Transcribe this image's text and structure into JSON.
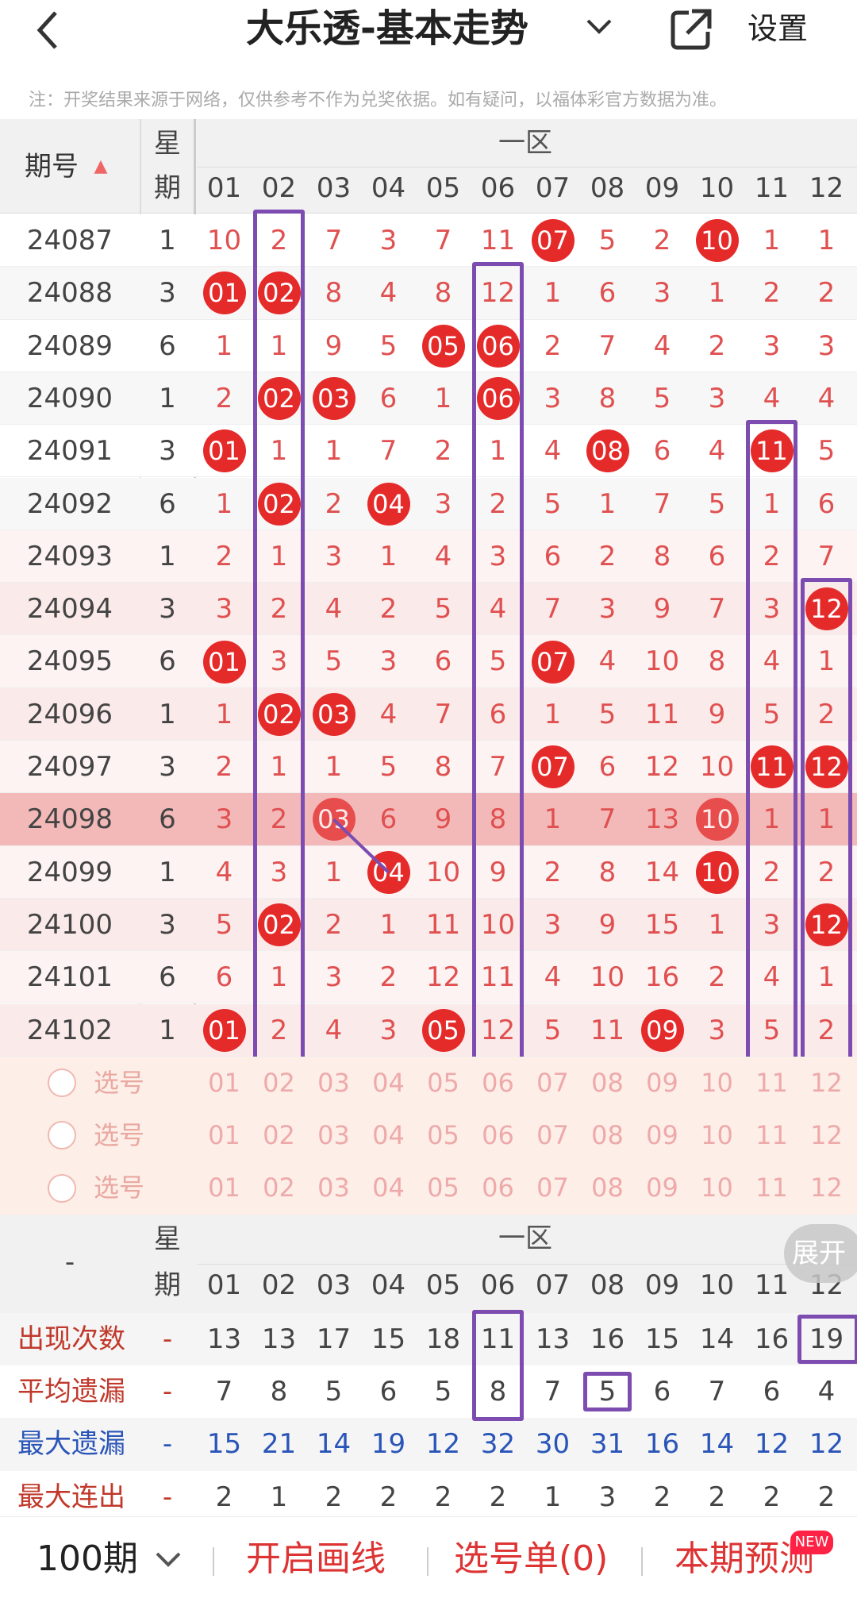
{
  "header": {
    "back_icon": "chevron-left-icon",
    "title": "大乐透-基本走势",
    "title_chevron": "chevron-down-icon",
    "share_icon": "share-external-icon",
    "settings_label": "设置"
  },
  "note": "注：开奖结果来源于网络，仅供参考不作为兑奖依据。如有疑问，以福体彩官方数据为准。",
  "table": {
    "col_period": "期号",
    "sort_icon": "sort-arrows-icon",
    "col_week_1": "星",
    "col_week_2": "期",
    "zone_label": "一区",
    "columns": [
      "01",
      "02",
      "03",
      "04",
      "05",
      "06",
      "07",
      "08",
      "09",
      "10",
      "11",
      "12"
    ],
    "rows": [
      {
        "period": "24087",
        "week": "1",
        "cells": [
          "10",
          "2",
          "7",
          "3",
          "7",
          "11",
          "07",
          "5",
          "2",
          "10",
          "1",
          "1"
        ],
        "hits": [
          6,
          9
        ]
      },
      {
        "period": "24088",
        "week": "3",
        "cells": [
          "01",
          "02",
          "8",
          "4",
          "8",
          "12",
          "1",
          "6",
          "3",
          "1",
          "2",
          "2"
        ],
        "hits": [
          0,
          1
        ]
      },
      {
        "period": "24089",
        "week": "6",
        "cells": [
          "1",
          "1",
          "9",
          "5",
          "05",
          "06",
          "2",
          "7",
          "4",
          "2",
          "3",
          "3"
        ],
        "hits": [
          4,
          5
        ]
      },
      {
        "period": "24090",
        "week": "1",
        "cells": [
          "2",
          "02",
          "03",
          "6",
          "1",
          "06",
          "3",
          "8",
          "5",
          "3",
          "4",
          "4"
        ],
        "hits": [
          1,
          2,
          5
        ]
      },
      {
        "period": "24091",
        "week": "3",
        "cells": [
          "01",
          "1",
          "1",
          "7",
          "2",
          "1",
          "4",
          "08",
          "6",
          "4",
          "11",
          "5"
        ],
        "hits": [
          0,
          7,
          10
        ]
      },
      {
        "period": "24092",
        "week": "6",
        "cells": [
          "1",
          "02",
          "2",
          "04",
          "3",
          "2",
          "5",
          "1",
          "7",
          "5",
          "1",
          "6"
        ],
        "hits": [
          1,
          3
        ]
      },
      {
        "period": "24093",
        "week": "1",
        "cells": [
          "2",
          "1",
          "3",
          "1",
          "4",
          "3",
          "6",
          "2",
          "8",
          "6",
          "2",
          "7"
        ],
        "hits": []
      },
      {
        "period": "24094",
        "week": "3",
        "cells": [
          "3",
          "2",
          "4",
          "2",
          "5",
          "4",
          "7",
          "3",
          "9",
          "7",
          "3",
          "12"
        ],
        "hits": [
          11
        ]
      },
      {
        "period": "24095",
        "week": "6",
        "cells": [
          "01",
          "3",
          "5",
          "3",
          "6",
          "5",
          "07",
          "4",
          "10",
          "8",
          "4",
          "1"
        ],
        "hits": [
          0,
          6
        ]
      },
      {
        "period": "24096",
        "week": "1",
        "cells": [
          "1",
          "02",
          "03",
          "4",
          "7",
          "6",
          "1",
          "5",
          "11",
          "9",
          "5",
          "2"
        ],
        "hits": [
          1,
          2
        ]
      },
      {
        "period": "24097",
        "week": "3",
        "cells": [
          "2",
          "1",
          "1",
          "5",
          "8",
          "7",
          "07",
          "6",
          "12",
          "10",
          "11",
          "12"
        ],
        "hits": [
          6,
          10,
          11
        ]
      },
      {
        "period": "24098",
        "week": "6",
        "cells": [
          "3",
          "2",
          "03",
          "6",
          "9",
          "8",
          "1",
          "7",
          "13",
          "10",
          "1",
          "1"
        ],
        "hits": [
          2,
          9
        ]
      },
      {
        "period": "24099",
        "week": "1",
        "cells": [
          "4",
          "3",
          "1",
          "04",
          "10",
          "9",
          "2",
          "8",
          "14",
          "10",
          "2",
          "2"
        ],
        "hits": [
          3,
          9
        ]
      },
      {
        "period": "24100",
        "week": "3",
        "cells": [
          "5",
          "02",
          "2",
          "1",
          "11",
          "10",
          "3",
          "9",
          "15",
          "1",
          "3",
          "12"
        ],
        "hits": [
          1,
          11
        ]
      },
      {
        "period": "24101",
        "week": "6",
        "cells": [
          "6",
          "1",
          "3",
          "2",
          "12",
          "11",
          "4",
          "10",
          "16",
          "2",
          "4",
          "1"
        ],
        "hits": []
      },
      {
        "period": "24102",
        "week": "1",
        "cells": [
          "01",
          "2",
          "4",
          "3",
          "05",
          "12",
          "5",
          "11",
          "09",
          "3",
          "5",
          "2"
        ],
        "hits": [
          0,
          4,
          8
        ]
      }
    ],
    "select_rows": [
      {
        "radio_icon": "radio-empty-icon",
        "label": "选号"
      },
      {
        "radio_icon": "radio-empty-icon",
        "label": "选号"
      },
      {
        "radio_icon": "radio-empty-icon",
        "label": "选号"
      }
    ]
  },
  "stats": {
    "dash": "-",
    "week_1": "星",
    "week_2": "期",
    "zone_label": "一区",
    "expand_label": "展开",
    "rows": [
      {
        "label": "出现次数",
        "week": "-",
        "values": [
          "13",
          "13",
          "17",
          "15",
          "18",
          "11",
          "13",
          "16",
          "15",
          "14",
          "16",
          "19"
        ],
        "color": "#c0392b"
      },
      {
        "label": "平均遗漏",
        "week": "-",
        "values": [
          "7",
          "8",
          "5",
          "6",
          "5",
          "8",
          "7",
          "5",
          "6",
          "7",
          "6",
          "4"
        ],
        "color": "#c0392b"
      },
      {
        "label": "最大遗漏",
        "week": "-",
        "values": [
          "15",
          "21",
          "14",
          "19",
          "12",
          "32",
          "30",
          "31",
          "16",
          "14",
          "12",
          "12"
        ],
        "color": "#2a55b8"
      },
      {
        "label": "最大连出",
        "week": "-",
        "values": [
          "2",
          "1",
          "2",
          "2",
          "2",
          "2",
          "1",
          "3",
          "2",
          "2",
          "2",
          "2"
        ],
        "color": "#c0392b"
      }
    ]
  },
  "bottom": {
    "periods_label": "100期",
    "periods_chevron": "chevron-down-icon",
    "draw_label": "开启画线",
    "list_label": "选号单(0)",
    "predict_label": "本期预测",
    "new_badge": "NEW"
  },
  "colors": {
    "accent": "#e52a2a",
    "box": "#7c4cb0",
    "highlight_row": "#f3b9b9"
  }
}
